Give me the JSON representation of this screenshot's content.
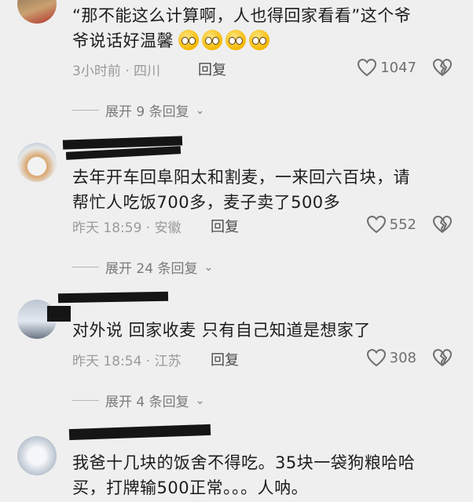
{
  "comments": [
    {
      "text_line1": "“那不能这么计算啊，人也得回家看看”这个爷",
      "text_line2": "爷说话好温馨",
      "time_location": "3小时前 · 四川",
      "reply_label": "回复",
      "likes": "1047",
      "expand": "展开 9 条回复",
      "emoji_icon": "pleading-face-icon"
    },
    {
      "text_line1": "去年开车回阜阳太和割麦，一来回六百块，请",
      "text_line2": "帮忙人吃饭700多，麦子卖了500多",
      "time_location": "昨天 18:59 · 安徽",
      "reply_label": "回复",
      "likes": "552",
      "expand": "展开 24 条回复"
    },
    {
      "text_line1": "对外说 回家收麦 只有自己知道是想家了",
      "time_location": "昨天 18:54 · 江苏",
      "reply_label": "回复",
      "likes": "308",
      "expand": "展开 4 条回复"
    },
    {
      "text_line1": "我爸十几块的饭舍不得吃。35块一袋狗粮哈哈",
      "text_line2": "买，打牌输500正常。。。人呐。"
    }
  ],
  "colors": {
    "background": "#efefef",
    "text": "#1c1c1c",
    "meta": "#9a9a9a",
    "redaction": "#151515"
  }
}
